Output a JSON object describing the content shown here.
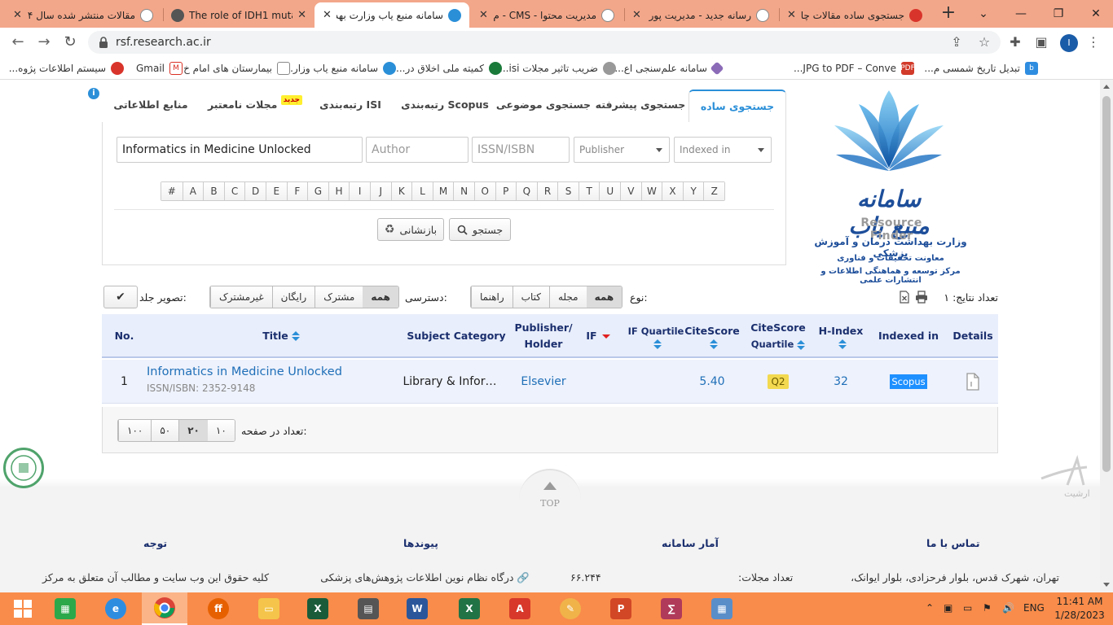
{
  "browser": {
    "tabs": [
      {
        "title": "مقالات منتشر شده سال ۱۴",
        "active": false,
        "ltr": false
      },
      {
        "title": "The role of IDH1 mutati",
        "active": false,
        "ltr": true
      },
      {
        "title": "سامانه منبع یاب وزارت بهد",
        "active": true,
        "ltr": false
      },
      {
        "title": "مدیریت محتوا - CMS - م",
        "active": false,
        "ltr": false
      },
      {
        "title": "رسانه جدید - مدیریت پور",
        "active": false,
        "ltr": false
      },
      {
        "title": "جستجوی ساده مقالات چا",
        "active": false,
        "ltr": false
      }
    ],
    "new_tab": "+",
    "url": "rsf.research.ac.ir",
    "profile_initial": "I",
    "bookmarks": [
      "تبدیل تاریخ شمسی م...",
      "JPG to PDF – Conve...",
      "سامانه علم‌سنجی اع...",
      "ضریب تاثیر مجلات isi...",
      "کمیته ملی اخلاق در...",
      "سامانه منبع یاب وزار...",
      "بیمارستان های امام خ...",
      "Gmail",
      "سیستم اطلاعات پژوه..."
    ]
  },
  "logo": {
    "fa": "سامانه منبع یاب",
    "en": "Resource Finder",
    "line1": "وزارت بهداشت درمان و آموزش پزشکی",
    "line2": "معاونت تحقیقات و فناوری",
    "line3": "مرکز توسعه و هماهنگی اطلاعات و انتشارات علمی"
  },
  "search_tabs": {
    "simple": "جستجوی ساده",
    "advanced": "جستجوی پیشرفته",
    "subject": "جستجوی موضوعی",
    "scopus": "رتبه‌بندی Scopus",
    "isi": "رتبه‌بندی ISI",
    "invalid": "مجلات نامعتبر",
    "new_badge": "جدید",
    "sources": "منابع اطلاعاتی",
    "info_icon": "i"
  },
  "search": {
    "title_value": "Informatics in Medicine Unlocked",
    "author_placeholder": "Author",
    "issn_placeholder": "ISSN/ISBN",
    "publisher_placeholder": "Publisher",
    "indexed_placeholder": "Indexed in",
    "letters": [
      "#",
      "A",
      "B",
      "C",
      "D",
      "E",
      "F",
      "G",
      "H",
      "I",
      "J",
      "K",
      "L",
      "M",
      "N",
      "O",
      "P",
      "Q",
      "R",
      "S",
      "T",
      "U",
      "V",
      "W",
      "X",
      "Y",
      "Z"
    ],
    "search_button": "جستجو",
    "reset_button": "بازنشانی"
  },
  "results_bar": {
    "count_text": "تعداد نتایج: ۱",
    "type_label": "نوع:",
    "type_options": [
      "همه",
      "مجله",
      "کتاب",
      "راهنما"
    ],
    "access_label": "دسترسی:",
    "access_options": [
      "همه",
      "مشترک",
      "رایگان",
      "غیرمشترک"
    ],
    "cover_label": "تصویر جلد:",
    "check_glyph": "✔"
  },
  "table": {
    "headers": {
      "no": "No.",
      "title": "Title",
      "subject": "Subject Category",
      "publisher_1": "Publisher/",
      "publisher_2": "Holder",
      "if": "IF",
      "if_quartile_1": "IF",
      "if_quartile_2": "Quartile",
      "citescore": "CiteScore",
      "cs_quartile_1": "CiteScore",
      "cs_quartile_2": "Quartile",
      "hindex": "H-Index",
      "indexed": "Indexed in",
      "details": "Details"
    },
    "rows": [
      {
        "no": "1",
        "title": "Informatics in Medicine Unlocked",
        "issn": "ISSN/ISBN: 2352-9148",
        "subject": "Library & Infor…",
        "publisher": "Elsevier",
        "if": "",
        "if_quartile": "",
        "citescore": "5.40",
        "cs_quartile": "Q2",
        "hindex": "32",
        "indexed": "Scopus"
      }
    ]
  },
  "pager": {
    "label": "تعداد در صفحه:",
    "options": [
      "۱۰",
      "۲۰",
      "۵۰",
      "۱۰۰"
    ],
    "selected": "۲۰"
  },
  "footer": {
    "top_text": "TOP",
    "arshit": "ارشیت",
    "h_contact": "تماس با ما",
    "h_stats": "آمار سامانه",
    "h_links": "پیوندها",
    "h_notice": "توجه",
    "contact_text": "تهران، شهرک قدس، بلوار فرحزادی، بلوار ایوانک،",
    "stats_label": "تعداد مجلات:",
    "stats_value": "۶۶.۲۴۴",
    "links_text": "درگاه نظام نوین اطلاعات پژوهش‌های پزشکی",
    "notice_text": "کلیه حقوق این وب سایت و مطالب آن متعلق به مرکز"
  },
  "taskbar": {
    "language": "ENG",
    "time": "11:41 AM",
    "date": "1/28/2023"
  },
  "colors": {
    "chrome_tabstrip": "#f3a78a",
    "taskbar": "#f98c4a",
    "accent": "#2b8fd8",
    "header_text": "#1b2f6e"
  }
}
